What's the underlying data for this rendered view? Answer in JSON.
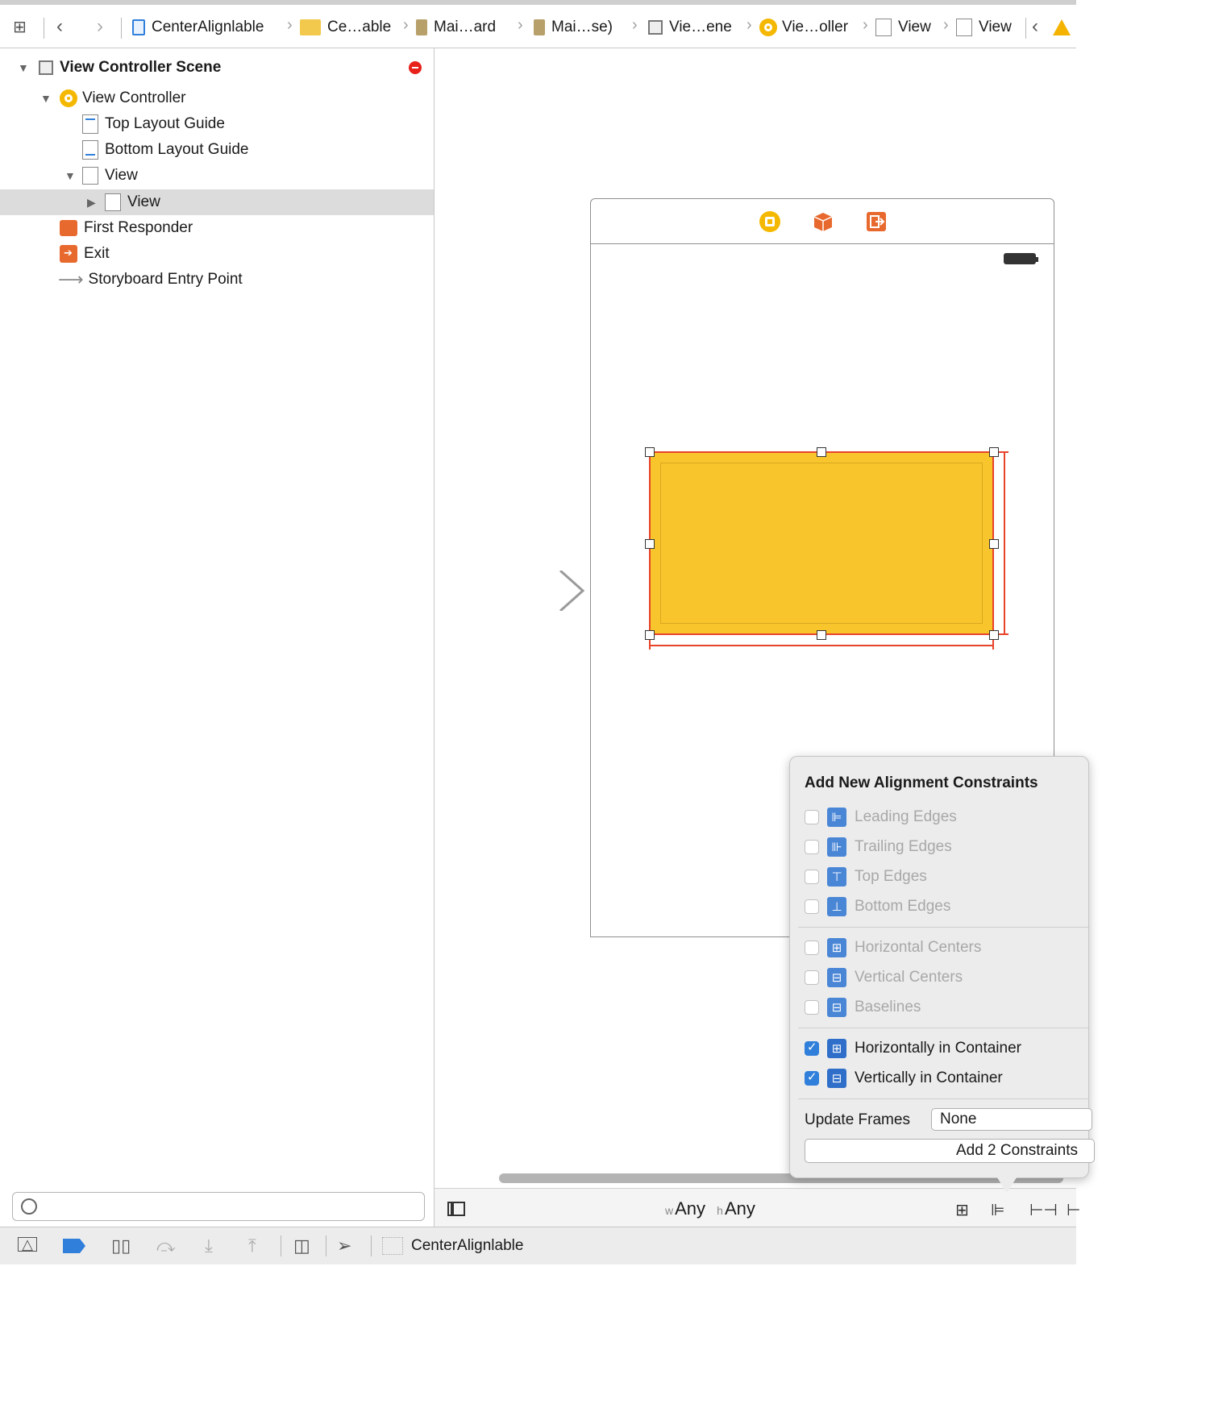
{
  "jumpbar": {
    "crumbs": [
      "CenterAlignlable",
      "Ce…able",
      "Mai…ard",
      "Mai…se)",
      "Vie…ene",
      "Vie…oller",
      "View",
      "View"
    ]
  },
  "outline": {
    "items": [
      {
        "label": "View Controller Scene"
      },
      {
        "label": "View Controller"
      },
      {
        "label": "Top Layout Guide"
      },
      {
        "label": "Bottom Layout Guide"
      },
      {
        "label": "View"
      },
      {
        "label": "View"
      },
      {
        "label": "First Responder"
      },
      {
        "label": "Exit"
      },
      {
        "label": "Storyboard Entry Point"
      }
    ]
  },
  "popover": {
    "title": "Add New Alignment Constraints",
    "options": [
      {
        "label": "Leading Edges",
        "checked": false,
        "enabled": false
      },
      {
        "label": "Trailing Edges",
        "checked": false,
        "enabled": false
      },
      {
        "label": "Top Edges",
        "checked": false,
        "enabled": false
      },
      {
        "label": "Bottom Edges",
        "checked": false,
        "enabled": false
      },
      {
        "label": "Horizontal Centers",
        "checked": false,
        "enabled": false
      },
      {
        "label": "Vertical Centers",
        "checked": false,
        "enabled": false
      },
      {
        "label": "Baselines",
        "checked": false,
        "enabled": false
      },
      {
        "label": "Horizontally in Container",
        "checked": true,
        "enabled": true
      },
      {
        "label": "Vertically in Container",
        "checked": true,
        "enabled": true
      }
    ],
    "update_frames_label": "Update Frames",
    "update_frames_value": "None",
    "add_button": "Add 2 Constraints"
  },
  "canvasbar": {
    "w_prefix": "w",
    "w_value": "Any",
    "h_prefix": "h",
    "h_value": "Any"
  },
  "debugbar": {
    "app_name": "CenterAlignlable"
  },
  "colors": {
    "view_fill": "#f8c52d",
    "constraint_red": "#e8442a",
    "accent_blue": "#2f7fdb",
    "selection": "#dcdcdc"
  }
}
